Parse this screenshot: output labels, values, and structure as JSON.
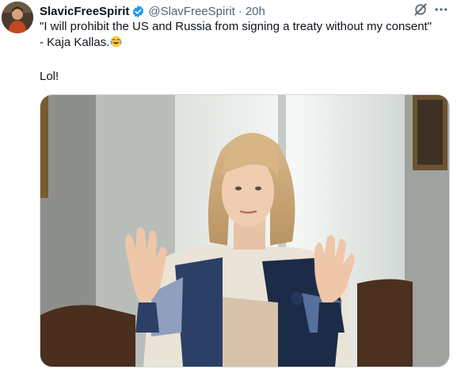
{
  "tweet": {
    "author_name": "SlavicFreeSpirit",
    "handle": "@SlavFreeSpirit",
    "separator": "·",
    "time": "20h",
    "text_line1": "\"I will prohibit the US and Russia from signing a treaty without my consent\"",
    "text_line2": "- Kaja Kallas.",
    "emoji": "face-with-tears-of-joy",
    "text_line3": "Lol!"
  },
  "icons": {
    "verified": "verified-badge-icon",
    "grok": "grok-icon",
    "more": "more-horizontal-icon"
  },
  "colors": {
    "verified": "#1d9bf0",
    "text": "#0f1419",
    "secondary": "#536471",
    "border": "#cfd9de"
  }
}
